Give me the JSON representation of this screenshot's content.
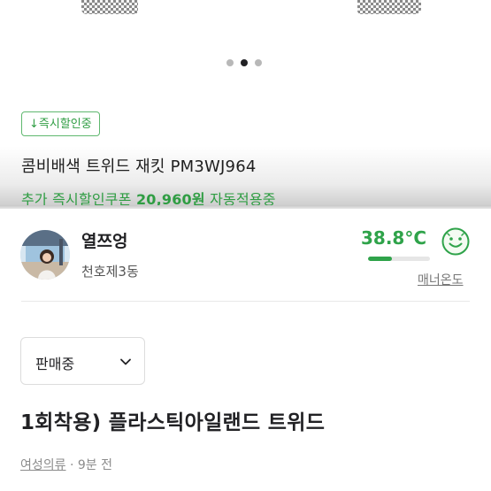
{
  "carousel": {
    "total": 3,
    "active_index": 1
  },
  "product": {
    "badge_label": "↓즉시할인중",
    "name": "콤비배색 트위드 재킷 PM3WJ964",
    "coupon_prefix": "추가 즉시할인쿠폰",
    "coupon_amount": "20,960원",
    "coupon_suffix": "자동적용중"
  },
  "seller": {
    "name": "열쯔엉",
    "region": "천호제3동",
    "temperature": "38.8°C",
    "temperature_level_percent": 38.8,
    "manner_label": "매너온도",
    "accent_color": "#2fa34a"
  },
  "listing": {
    "status": "판매중",
    "title": "1회착용) 플라스틱아일랜드 트위드",
    "category": "여성의류",
    "separator": "·",
    "posted": "9분 전"
  }
}
